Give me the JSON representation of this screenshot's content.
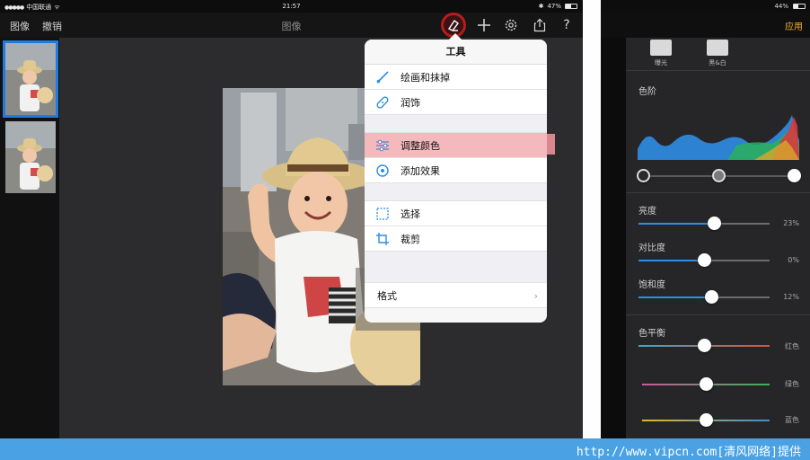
{
  "left": {
    "status": {
      "carrier": "中国联通",
      "time": "21:57",
      "battery": "47%",
      "battery_fraction": 0.47
    },
    "topbar": {
      "images_label": "图像",
      "undo_label": "撤销",
      "title": "图像"
    },
    "icons": [
      "tools-icon",
      "plus-icon",
      "gear-icon",
      "share-icon",
      "help-icon"
    ],
    "popover": {
      "title": "工具",
      "items": [
        {
          "label": "绘画和抹掉",
          "icon": "brush-icon"
        },
        {
          "label": "润饰",
          "icon": "bandage-icon"
        },
        {
          "label": "调整颜色",
          "icon": "sliders-icon",
          "highlighted": true
        },
        {
          "label": "添加效果",
          "icon": "effects-icon"
        },
        {
          "label": "选择",
          "icon": "selection-icon"
        },
        {
          "label": "裁剪",
          "icon": "crop-icon"
        },
        {
          "label": "格式",
          "icon": "chevron-right-icon"
        }
      ]
    }
  },
  "right": {
    "status": {
      "battery": "44%",
      "battery_fraction": 0.44
    },
    "apply_label": "应用",
    "filters": [
      {
        "label": "曝光"
      },
      {
        "label": "黑&白"
      }
    ],
    "levels_label": "色阶",
    "levels_knobs": [
      0.0,
      0.5,
      1.0
    ],
    "adjustments": [
      {
        "label": "亮度",
        "value": "23%",
        "fraction": 0.58
      },
      {
        "label": "对比度",
        "value": "0%",
        "fraction": 0.5
      },
      {
        "label": "饱和度",
        "value": "12%",
        "fraction": 0.56
      }
    ],
    "color_balance_label": "色平衡",
    "color_balance": [
      {
        "label": "红色",
        "fraction": 0.5,
        "colors": [
          "#3aa9c7",
          "#d9533a"
        ]
      },
      {
        "label": "绿色",
        "fraction": 0.5,
        "colors": [
          "#c75a9e",
          "#3fae5a"
        ]
      },
      {
        "label": "蓝色",
        "fraction": 0.5,
        "colors": [
          "#e1b629",
          "#3b8fd6"
        ]
      }
    ]
  },
  "footer": {
    "watermark": "http://www.vipcn.com[清风网络]提供"
  },
  "colors": {
    "accent": "#2f8de4",
    "apply": "#f0b12b",
    "selection": "#1e7be0",
    "highlight": "#f4b9bd",
    "footer": "#4aa2e4"
  }
}
